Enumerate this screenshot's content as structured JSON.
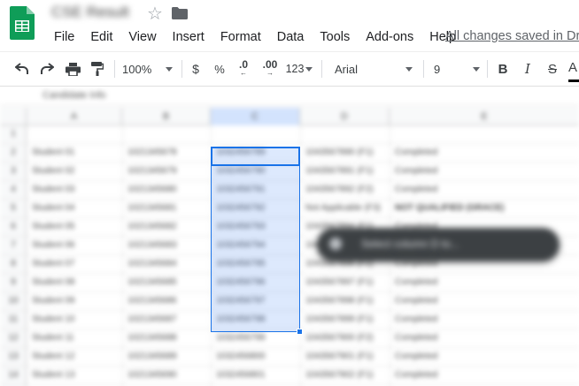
{
  "document": {
    "title": "CSE Result"
  },
  "menu": [
    "File",
    "Edit",
    "View",
    "Insert",
    "Format",
    "Data",
    "Tools",
    "Add-ons",
    "Help"
  ],
  "save_status": "All changes saved in Drive",
  "toolbar": {
    "zoom": "100%",
    "currency": "$",
    "percent": "%",
    "decrease_decimal": ".0",
    "increase_decimal": ".00",
    "more_formats": "123",
    "font": "Arial",
    "font_size": "9",
    "bold": "B",
    "italic": "I",
    "strikethrough": "S",
    "text_color": "A"
  },
  "formula_bar": {
    "text": "Candidate Info"
  },
  "columns": [
    "A",
    "B",
    "C",
    "D",
    "E"
  ],
  "rows": [
    {
      "num": "1",
      "a": "",
      "b": "",
      "c": "",
      "d": "",
      "e": ""
    },
    {
      "num": "2",
      "a": "Student 01",
      "b": "1021345678",
      "c": "1032456789",
      "d": "1043567890 (F1)",
      "e": "Completed"
    },
    {
      "num": "3",
      "a": "Student 02",
      "b": "1021345679",
      "c": "1032456790",
      "d": "1043567891 (F1)",
      "e": "Completed"
    },
    {
      "num": "4",
      "a": "Student 03",
      "b": "1021345680",
      "c": "1032456791",
      "d": "1043567892 (F2)",
      "e": "Completed"
    },
    {
      "num": "5",
      "a": "Student 04",
      "b": "1021345681",
      "c": "1032456792",
      "d": "Not Applicable (F3)",
      "e": "NOT QUALIFIED (GRACE)"
    },
    {
      "num": "6",
      "a": "Student 05",
      "b": "1021345682",
      "c": "1032456793",
      "d": "1043567894 (F1)",
      "e": "Completed"
    },
    {
      "num": "7",
      "a": "Student 06",
      "b": "1021345683",
      "c": "1032456794",
      "d": "1043567895 (F1)",
      "e": "Completed"
    },
    {
      "num": "8",
      "a": "Student 07",
      "b": "1021345684",
      "c": "1032456795",
      "d": "1043567896 (F2)",
      "e": "Completed"
    },
    {
      "num": "9",
      "a": "Student 08",
      "b": "1021345685",
      "c": "1032456796",
      "d": "1043567897 (F1)",
      "e": "Completed"
    },
    {
      "num": "10",
      "a": "Student 09",
      "b": "1021345686",
      "c": "1032456797",
      "d": "1043567898 (F1)",
      "e": "Completed"
    },
    {
      "num": "11",
      "a": "Student 10",
      "b": "1021345687",
      "c": "1032456798",
      "d": "1043567899 (F1)",
      "e": "Completed"
    },
    {
      "num": "12",
      "a": "Student 11",
      "b": "1021345688",
      "c": "1032456799",
      "d": "1043567900 (F2)",
      "e": "Completed"
    },
    {
      "num": "13",
      "a": "Student 12",
      "b": "1021345689",
      "c": "1032456800",
      "d": "1043567901 (F1)",
      "e": "Completed"
    },
    {
      "num": "14",
      "a": "Student 13",
      "b": "1021345690",
      "c": "1032456801",
      "d": "1043567902 (F1)",
      "e": "Completed"
    }
  ],
  "snackbar": {
    "text": "Select column D to..."
  },
  "colors": {
    "accent": "#1a73e8",
    "sheets_green": "#0f9d58"
  }
}
